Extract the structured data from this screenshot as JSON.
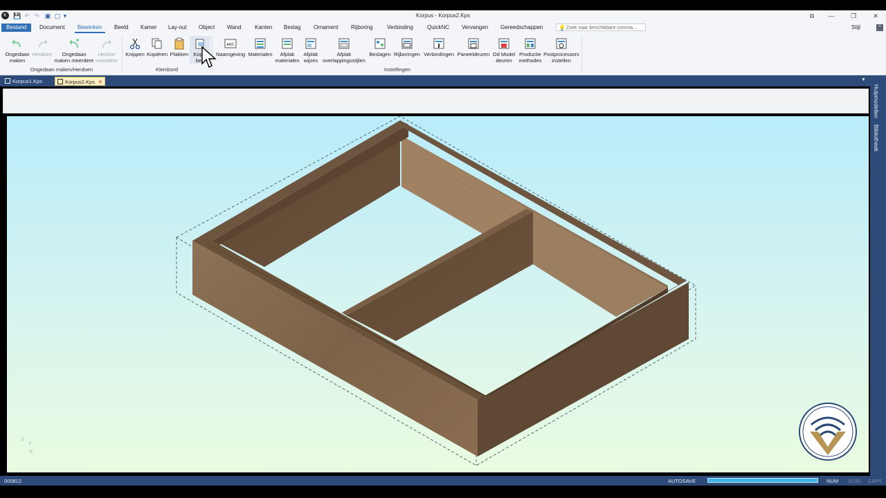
{
  "window": {
    "title": "Korpus - Korpus2.Kps",
    "controls": [
      "⧉",
      "—",
      "❐",
      "✕"
    ]
  },
  "quick_access": [
    "💾",
    "↶",
    "↷",
    "▣",
    "▢",
    "▾"
  ],
  "menu": {
    "file": "Bestand",
    "tabs": [
      "Document",
      "Bewerken",
      "Beeld",
      "Kamer",
      "Lay-out",
      "Object",
      "Wand",
      "Kanten",
      "Beslag",
      "Ornament",
      "Rijboring",
      "Verbinding",
      "QuickNC",
      "Vervangen",
      "Gereedschappen"
    ],
    "active_tab": "Bewerken",
    "search_placeholder": "Zoek naar beschikbare comma...",
    "style_label": "Stijl"
  },
  "ribbon": {
    "undo_group": {
      "label": "Ongedaan maken/Herdoen",
      "buttons": [
        {
          "label1": "Ongedaan",
          "label2": "maken",
          "icon": "undo-icon",
          "enabled": true
        },
        {
          "label1": "Herdoen",
          "label2": "",
          "icon": "redo-icon",
          "enabled": false
        },
        {
          "label1": "Ongedaan",
          "label2": "maken meerdere",
          "icon": "undo-multiple-icon",
          "enabled": true
        },
        {
          "label1": "Herdoe",
          "label2": "meerdere",
          "icon": "redo-multiple-icon",
          "enabled": false
        }
      ]
    },
    "clipboard_group": {
      "label": "Klembord",
      "buttons": [
        {
          "label1": "Knippen",
          "label2": "",
          "icon": "scissors-icon"
        },
        {
          "label1": "Kopiëren",
          "label2": "",
          "icon": "copy-icon"
        },
        {
          "label1": "Plakken",
          "label2": "",
          "icon": "paste-icon"
        },
        {
          "label1": "Kopie",
          "label2": "bee",
          "icon": "copy-image-icon"
        }
      ]
    },
    "settings_group": {
      "label": "Instellingen",
      "buttons": [
        {
          "label1": "Naamgeving",
          "label2": "",
          "icon": "abc-icon"
        },
        {
          "label1": "Materialen",
          "label2": "",
          "icon": "materials-icon"
        },
        {
          "label1": "Afplak",
          "label2": "materialen",
          "icon": "edge-materials-icon"
        },
        {
          "label1": "Afplak",
          "label2": "wijzes",
          "icon": "edge-modes-icon"
        },
        {
          "label1": "Afplak",
          "label2": "overlappingsstijlen",
          "icon": "edge-overlap-icon"
        },
        {
          "label1": "Beslagen",
          "label2": "",
          "icon": "hardware-icon"
        },
        {
          "label1": "Rijboringen",
          "label2": "",
          "icon": "row-drilling-icon"
        },
        {
          "label1": "Verbindingen",
          "label2": "",
          "icon": "connections-icon"
        },
        {
          "label1": "Paneeldeuren",
          "label2": "",
          "icon": "panel-doors-icon"
        },
        {
          "label1": "Od Model",
          "label2": "deuren",
          "icon": "model-doors-icon"
        },
        {
          "label1": "Productie",
          "label2": "methodes",
          "icon": "production-icon"
        },
        {
          "label1": "Postprocessors",
          "label2": "instellen",
          "icon": "postprocessor-icon"
        }
      ]
    }
  },
  "doc_tabs": [
    {
      "label": "Korpus1.Kps",
      "active": false
    },
    {
      "label": "Korpus2.Kps",
      "active": true
    }
  ],
  "doc_tab_close": "✕",
  "side_panel": {
    "label1": "Hulpmodellen",
    "label2": "Bibliotheek"
  },
  "viewport": {
    "axis_x": "X",
    "axis_y": "Y",
    "axis_z": "Z"
  },
  "status": {
    "left": "000812",
    "autosave": "AUTOSAVE",
    "num": "NUM",
    "scrl": "SCRL",
    "caps": "CAPS",
    "progress": 1.0
  },
  "colors": {
    "accent": "#2f6fb6",
    "panel_dark": "#2e4a78",
    "wood_top": "#6a5139",
    "wood_side": "#8b6e52",
    "wood_inner": "#5b4530"
  }
}
